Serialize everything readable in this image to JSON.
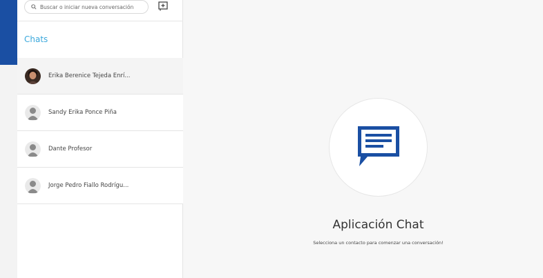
{
  "search": {
    "placeholder": "Buscar o iniciar nueva conversación"
  },
  "sidebar": {
    "heading": "Chats",
    "chats": [
      {
        "name": "Erika Berenice Tejeda Enrí...",
        "avatar": "photo-avatar",
        "active": true
      },
      {
        "name": "Sandy Erika Ponce Piña",
        "avatar": "default-user-avatar",
        "active": false
      },
      {
        "name": "Dante Profesor",
        "avatar": "default-user-avatar",
        "active": false
      },
      {
        "name": "Jorge Pedro Fiallo Rodrígu...",
        "avatar": "default-user-avatar",
        "active": false
      }
    ]
  },
  "main": {
    "title": "Aplicación Chat",
    "subtitle": "Selecciona un contacto para comenzar una conversación!",
    "logo_icon": "chat-bubble-icon"
  },
  "colors": {
    "accent_blue": "#1a4fa3",
    "chats_heading": "#3aa8dc"
  }
}
